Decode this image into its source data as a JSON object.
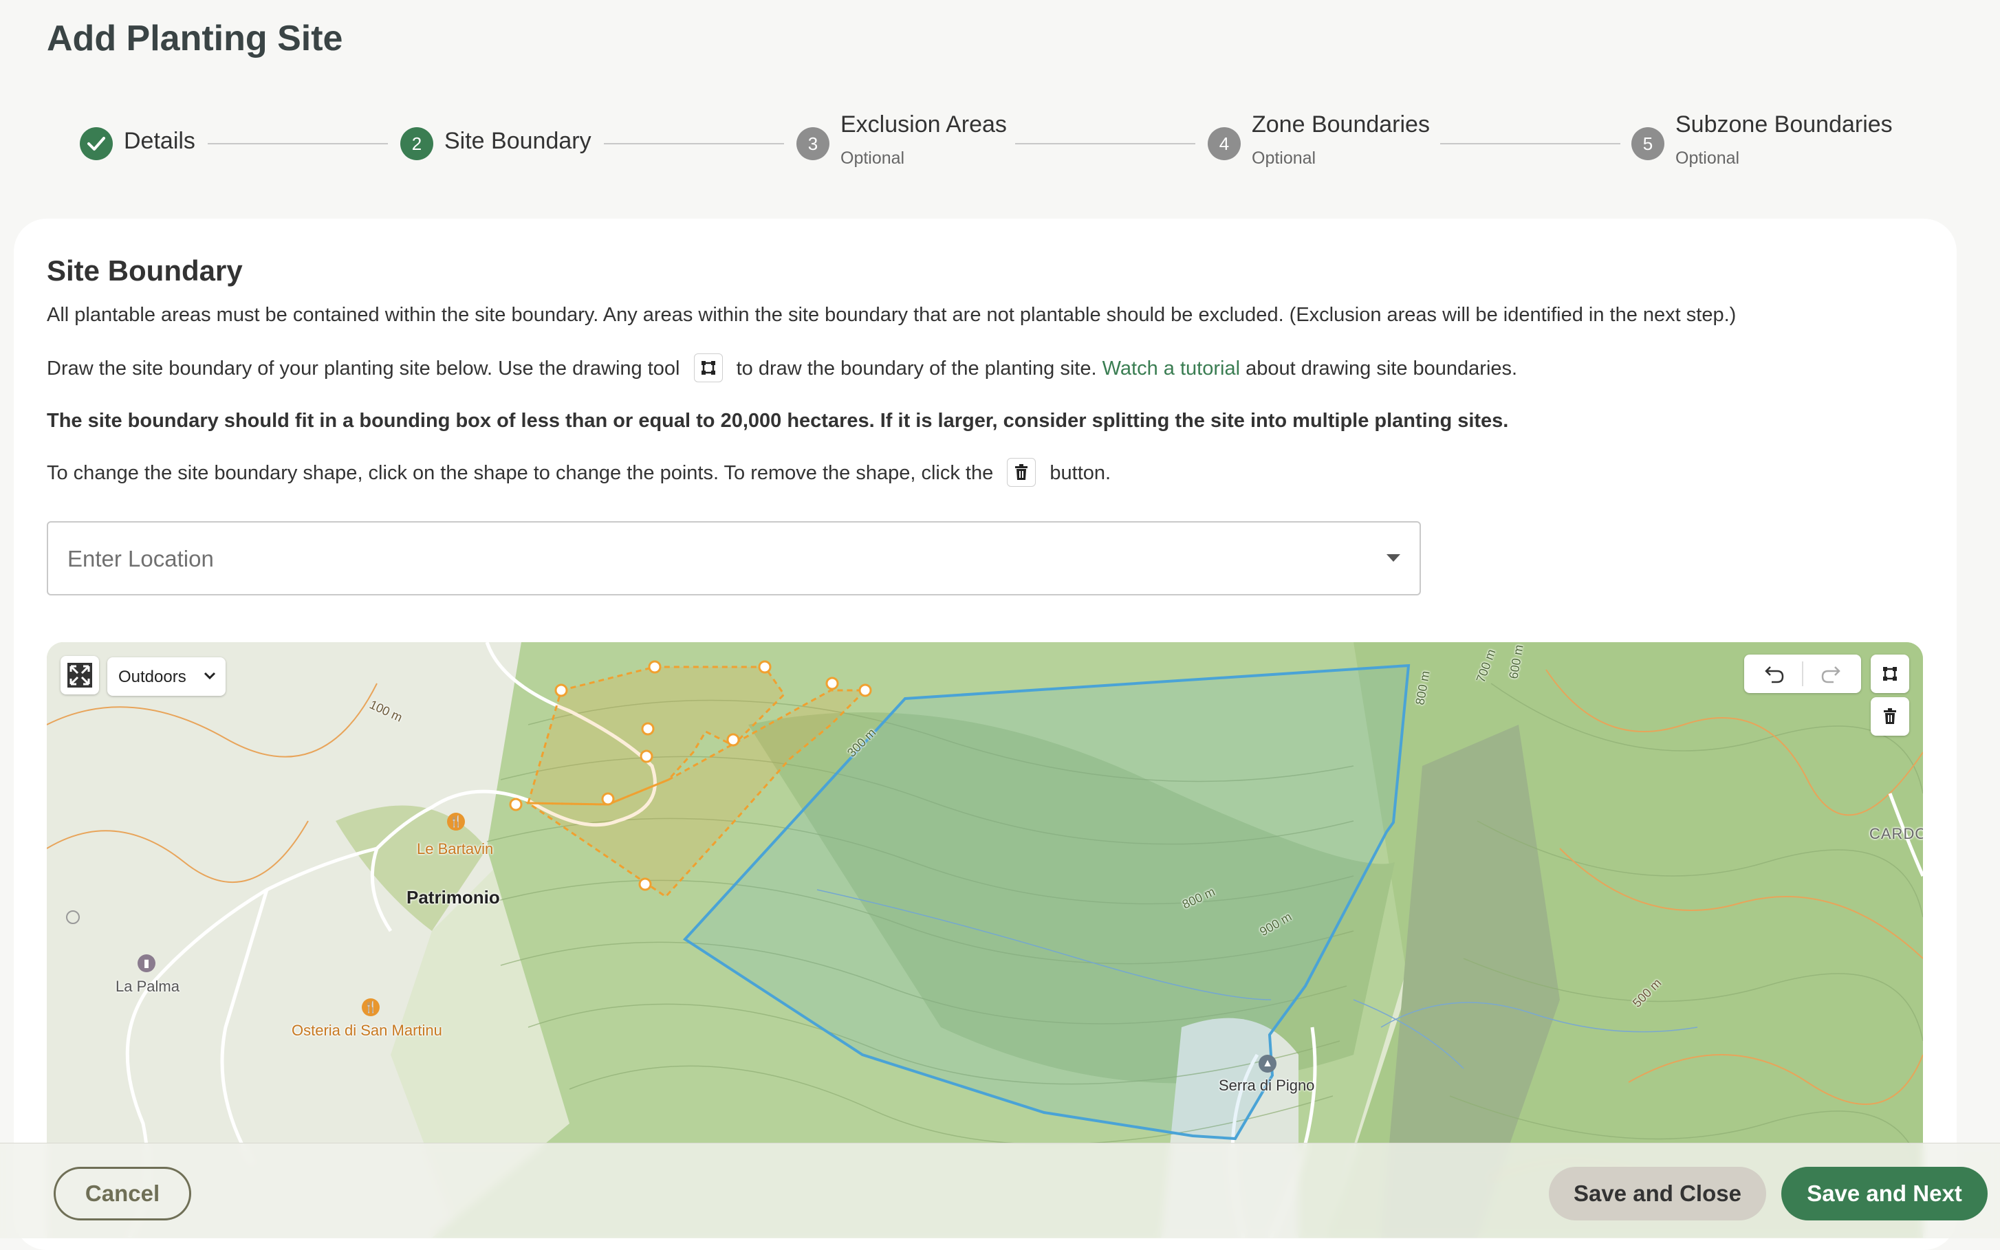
{
  "page": {
    "title": "Add Planting Site"
  },
  "stepper": {
    "steps": [
      {
        "number": "1",
        "label": "Details",
        "status": "done",
        "sub": ""
      },
      {
        "number": "2",
        "label": "Site Boundary",
        "status": "active",
        "sub": ""
      },
      {
        "number": "3",
        "label": "Exclusion Areas",
        "status": "pending",
        "sub": "Optional"
      },
      {
        "number": "4",
        "label": "Zone Boundaries",
        "status": "pending",
        "sub": "Optional"
      },
      {
        "number": "5",
        "label": "Subzone Boundaries",
        "status": "pending",
        "sub": "Optional"
      }
    ]
  },
  "section": {
    "title": "Site Boundary",
    "p1": "All plantable areas must be contained within the site boundary. Any areas within the site boundary that are not plantable should be excluded. (Exclusion areas will be identified in the next step.)",
    "p2_a": "Draw the site boundary of your planting site below. Use the drawing tool",
    "p2_b": "to draw the boundary of the planting site.",
    "p2_link": "Watch a tutorial",
    "p2_c": "about drawing site boundaries.",
    "p3": "The site boundary should fit in a bounding box of less than or equal to 20,000 hectares. If it is larger, consider splitting the site into multiple planting sites.",
    "p4_a": "To change the site boundary shape, click on the shape to change the points. To remove the shape, click the",
    "p4_b": "button."
  },
  "location": {
    "placeholder": "Enter Location"
  },
  "map": {
    "style_label": "Outdoors",
    "labels": {
      "patrimonio": "Patrimonio",
      "le_bartavin": "Le Bartavin",
      "la_palma": "La Palma",
      "osteria": "Osteria di San Martinu",
      "serra": "Serra di Pigno",
      "cardo": "CARDO",
      "c100": "100 m",
      "c300": "300 m",
      "c800a": "800 m",
      "c800b": "800 m",
      "c900": "900 m",
      "c500": "500 m",
      "c700": "700 m",
      "c600": "600 m"
    },
    "colors": {
      "boundary": "#4aa3d6",
      "exclusion": "#f0a030",
      "terrain_light": "#dfe8cf",
      "terrain_green": "#a9c98a"
    }
  },
  "footer": {
    "cancel": "Cancel",
    "save_close": "Save and Close",
    "save_next": "Save and Next"
  }
}
